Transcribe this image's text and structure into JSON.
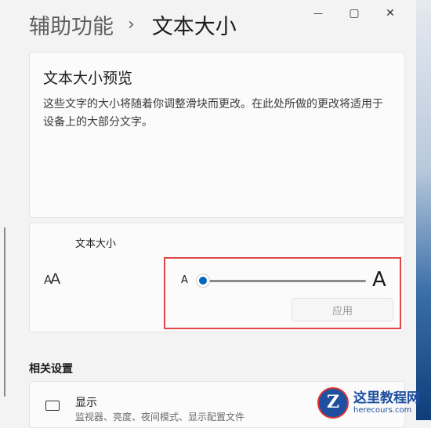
{
  "breadcrumb": {
    "parent": "辅助功能",
    "separator": "›",
    "current": "文本大小"
  },
  "window_controls": {
    "minimize": "—",
    "maximize": "▢",
    "close": "✕"
  },
  "preview": {
    "title": "文本大小预览",
    "text": "这些文字的大小将随着你调整滑块而更改。在此处所做的更改将适用于设备上的大部分文字。"
  },
  "text_size": {
    "label": "文本大小",
    "icon_small": "A",
    "icon_big": "A",
    "slider_min_label": "A",
    "slider_max_label": "A",
    "slider_value_fraction": 0.0,
    "apply_label": "应用",
    "apply_enabled": false
  },
  "related": {
    "header": "相关设置",
    "items": [
      {
        "title": "显示",
        "subtitle": "监视器、亮度、夜间模式、显示配置文件",
        "icon": "monitor-icon"
      }
    ]
  },
  "watermark": {
    "logo_letter": "Z",
    "name": "这里教程网",
    "url": "herecours.com"
  },
  "colors": {
    "accent": "#0067c0",
    "highlight_border": "#e04848"
  }
}
